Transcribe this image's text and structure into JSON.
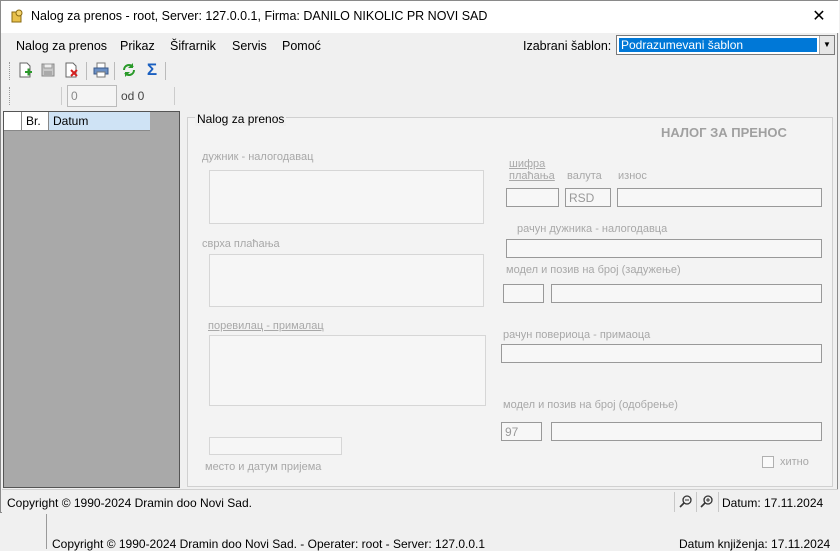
{
  "window": {
    "title": "Nalog za prenos - root, Server: 127.0.0.1, Firma: DANILO NIKOLIC PR NOVI SAD",
    "close_symbol": "✕"
  },
  "menu": {
    "items": [
      "Nalog za prenos",
      "Prikaz",
      "Šifrarnik",
      "Servis",
      "Pomoć"
    ],
    "template_label": "Izabrani šablon:",
    "template_value": "Podrazumevani šablon"
  },
  "toolbar": {
    "icons": [
      "new-document-icon",
      "save-icon",
      "delete-icon",
      "print-icon",
      "refresh-icon",
      "sum-icon"
    ],
    "sum_glyph": "Σ"
  },
  "navigation": {
    "position_value": "0",
    "of_text": "od 0"
  },
  "grid": {
    "columns": [
      "",
      "Br.",
      "Datum"
    ]
  },
  "form": {
    "panel_caption": "Nalog za prenos",
    "title": "НАЛОГ ЗА ПРЕНОС",
    "payer_label": "дужник - налогодавац",
    "purpose_label": "сврха плаћања",
    "recipient_label": "поревилац - прималац",
    "place_date_label": "место и датум пријема",
    "payment_code_label_line1": "шифра",
    "payment_code_label_line2": "плаћања",
    "currency_label": "валута",
    "currency_value": "RSD",
    "amount_label": "износ",
    "payer_account_label": "рачун дужника - налогодавца",
    "debit_model_label": "модел и позив на број (задужење)",
    "recipient_account_label": "рачун повериоца - примаоца",
    "credit_model_label": "модел и позив на број (одобрење)",
    "credit_model_value": "97",
    "urgent_label": "хитно"
  },
  "status_bar": {
    "copyright": "Copyright © 1990-2024 Dramin doo Novi Sad.",
    "date_text": "Datum: 17.11.2024"
  },
  "background_app": {
    "status_left": "Copyright © 1990-2024 Dramin doo Novi Sad. - Operater: root - Server: 127.0.0.1",
    "status_right": "Datum knjiženja: 17.11.2024"
  },
  "colors": {
    "selection": "#0078d7",
    "grid_background": "#a9a9a9",
    "disabled_text": "#a8a8a8"
  }
}
